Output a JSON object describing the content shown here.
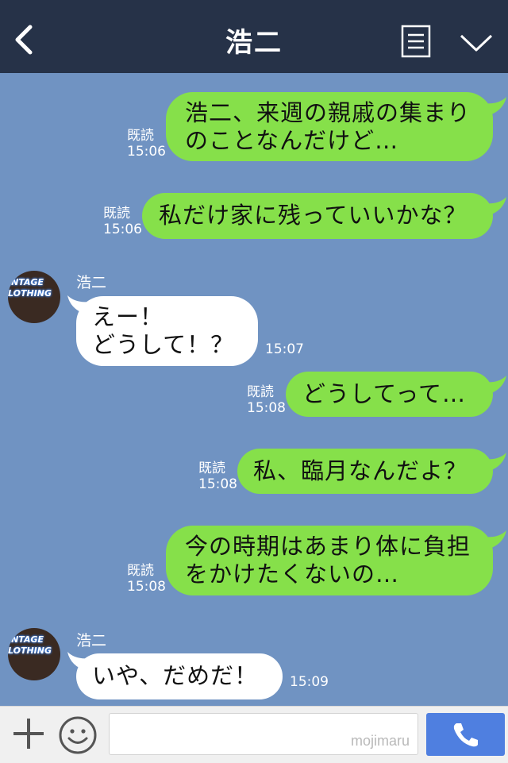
{
  "header": {
    "title": "浩二"
  },
  "messages": [
    {
      "from": "me",
      "lines": [
        "浩二、来週の親戚の集まり",
        "のことなんだけど…"
      ],
      "read": "既読",
      "time": "15:06"
    },
    {
      "from": "me",
      "lines": [
        "私だけ家に残っていいかな？"
      ],
      "read": "既読",
      "time": "15:06"
    },
    {
      "from": "them",
      "sender": "浩二",
      "lines": [
        "えー！",
        "どうして！？"
      ],
      "time": "15:07"
    },
    {
      "from": "me",
      "lines": [
        "どうしてって…"
      ],
      "read": "既読",
      "time": "15:08"
    },
    {
      "from": "me",
      "lines": [
        "私、臨月なんだよ？"
      ],
      "read": "既読",
      "time": "15:08"
    },
    {
      "from": "me",
      "lines": [
        "今の時期はあまり体に負担",
        "をかけたくないの…"
      ],
      "read": "既読",
      "time": "15:08"
    },
    {
      "from": "them",
      "sender": "浩二",
      "lines": [
        "いや、だめだ！"
      ],
      "time": "15:09"
    }
  ],
  "avatar": {
    "sign_line1": "INTAGE",
    "sign_line2": "LOTHING"
  },
  "footer": {
    "watermark": "mojimaru"
  },
  "colors": {
    "header": "#263248",
    "chat_bg": "#7093c2",
    "my_bubble": "#86e04a",
    "their_bubble": "#ffffff",
    "call": "#4f7fe0"
  },
  "icons": [
    "back-icon",
    "menu-icon",
    "chevron-down-icon",
    "plus-icon",
    "smile-icon",
    "phone-icon"
  ]
}
